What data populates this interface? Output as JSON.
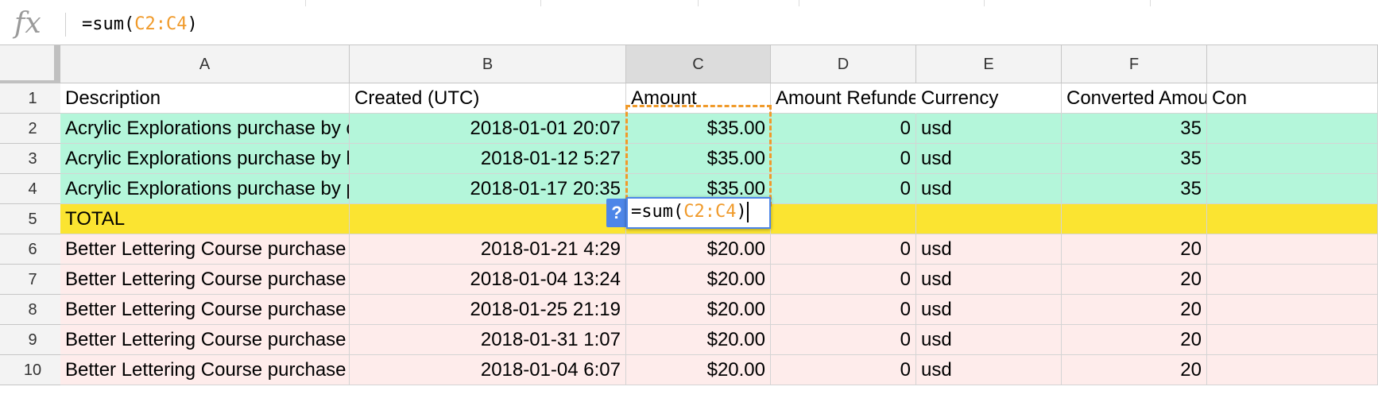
{
  "formula_bar": {
    "fx_label": "fx",
    "formula_prefix": "=sum(",
    "formula_ref": "C2:C4",
    "formula_suffix": ")"
  },
  "columns": [
    "A",
    "B",
    "C",
    "D",
    "E",
    "F"
  ],
  "selected_column": "C",
  "rows": [
    {
      "n": "1",
      "A": "Description",
      "B": "Created (UTC)",
      "C": "Amount",
      "D": "Amount Refunde",
      "E": "Currency",
      "F": "Converted Amou",
      "G": "Con"
    },
    {
      "n": "2",
      "A": "Acrylic Explorations purchase by d",
      "B": "2018-01-01 20:07",
      "C": "$35.00",
      "D": "0",
      "E": "usd",
      "F": "35",
      "G": ""
    },
    {
      "n": "3",
      "A": "Acrylic Explorations purchase by k",
      "B": "2018-01-12 5:27",
      "C": "$35.00",
      "D": "0",
      "E": "usd",
      "F": "35",
      "G": ""
    },
    {
      "n": "4",
      "A": "Acrylic Explorations purchase by p",
      "B": "2018-01-17 20:35",
      "C": "$35.00",
      "D": "0",
      "E": "usd",
      "F": "35",
      "G": ""
    },
    {
      "n": "5",
      "A": "TOTAL",
      "B": "",
      "C": "",
      "D": "",
      "E": "",
      "F": "",
      "G": ""
    },
    {
      "n": "6",
      "A": "Better Lettering Course purchase I",
      "B": "2018-01-21 4:29",
      "C": "$20.00",
      "D": "0",
      "E": "usd",
      "F": "20",
      "G": ""
    },
    {
      "n": "7",
      "A": "Better Lettering Course purchase I",
      "B": "2018-01-04 13:24",
      "C": "$20.00",
      "D": "0",
      "E": "usd",
      "F": "20",
      "G": ""
    },
    {
      "n": "8",
      "A": "Better Lettering Course purchase I",
      "B": "2018-01-25 21:19",
      "C": "$20.00",
      "D": "0",
      "E": "usd",
      "F": "20",
      "G": ""
    },
    {
      "n": "9",
      "A": "Better Lettering Course purchase I",
      "B": "2018-01-31 1:07",
      "C": "$20.00",
      "D": "0",
      "E": "usd",
      "F": "20",
      "G": ""
    },
    {
      "n": "10",
      "A": "Better Lettering Course purchase I",
      "B": "2018-01-04 6:07",
      "C": "$20.00",
      "D": "0",
      "E": "usd",
      "F": "20",
      "G": ""
    }
  ],
  "editor": {
    "help_label": "?",
    "formula_prefix": "=sum(",
    "formula_ref": "C2:C4",
    "formula_suffix": ")"
  },
  "colors": {
    "header_row": "#ffffff",
    "green_rows": "#b4f6da",
    "total_row": "#fbe431",
    "pink_rows": "#feeceb",
    "selection_dash": "#f09a2a",
    "editor_border": "#4d86e8"
  }
}
